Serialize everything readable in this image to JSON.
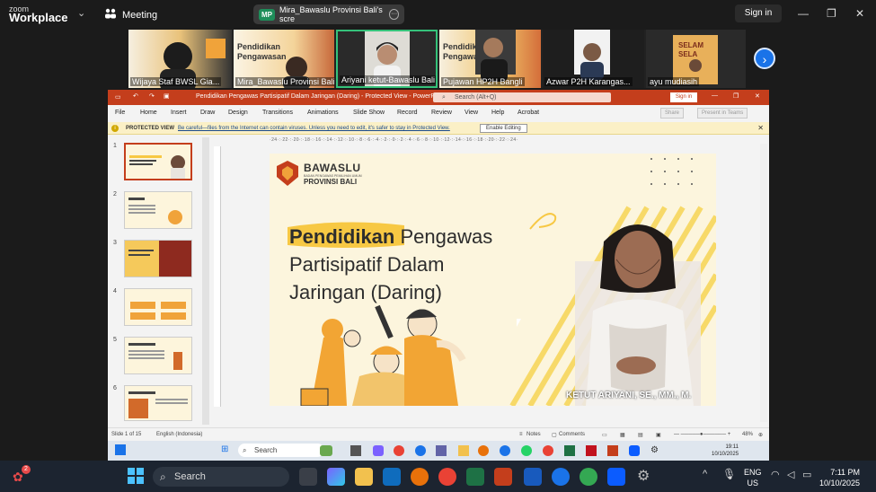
{
  "zoom": {
    "logo_line1": "zoom",
    "logo_line2": "Workplace",
    "meeting_label": "Meeting",
    "share_badge": "MP",
    "share_label": "Mira_Bawaslu Provinsi Bali's scre",
    "sign_in": "Sign in",
    "colors": {
      "bg": "#1b1b1b",
      "accent": "#1a73e8",
      "badge": "#1e8e5a"
    }
  },
  "participants": [
    {
      "name": "Wijaya Staf BWSL Gia..."
    },
    {
      "name": "Mira_Bawaslu Provinsi Bali"
    },
    {
      "name": "Ariyani ketut-Bawaslu Bali"
    },
    {
      "name": "Pujawan HP2H Bangli"
    },
    {
      "name": "Azwar P2H Karangas..."
    },
    {
      "name": "ayu mudiasih"
    }
  ],
  "ppt": {
    "title": "Pendidikan Pengawas Partisipatif Dalam Jaringan (Daring)  -  Protected View  -  PowerPoint",
    "search_placeholder": "Search (Alt+Q)",
    "sign_in": "Sign in",
    "menu": [
      "File",
      "Home",
      "Insert",
      "Draw",
      "Design",
      "Transitions",
      "Animations",
      "Slide Show",
      "Record",
      "Review",
      "View",
      "Help",
      "Acrobat"
    ],
    "share": "Share",
    "present": "Present in Teams",
    "protected_label": "PROTECTED VIEW",
    "protected_msg": "Be careful—files from the Internet can contain viruses. Unless you need to edit, it's safer to stay in Protected View.",
    "enable_editing": "Enable Editing",
    "thumb_numbers": [
      "1",
      "2",
      "3",
      "4",
      "5",
      "6"
    ],
    "ruler_top": "·24·:·22·:·20·:·18·:·16·:·14·:·12·:·10·:·8·:·6·:·4·:·2·:·0·:·2·:·4·:·6·:·8·:·10·:·12·:·14·:·16·:·18·:·20·:·22·:·24·",
    "status": {
      "slide_of": "Slide 1 of 15",
      "language": "English (Indonesia)",
      "notes": "Notes",
      "comments": "Comments",
      "zoom": "48%"
    },
    "colors": {
      "accent": "#c43e1c",
      "slide_bg": "#fcf5dd",
      "highlight": "#f7c843"
    }
  },
  "slide": {
    "brand": "BAWASLU",
    "brand_sub": "BADAN PENGAWAS PEMILIHAN UMUM",
    "brand_region": "PROVINSI BALI",
    "title_highlight": "Pendidikan",
    "title_rest1": " Pengawas",
    "title_line2": "Partisipatif Dalam",
    "title_line3": "Jaringan (Daring)",
    "speaker_caption": "KETUT ARIYANI, SE., MM., M."
  },
  "inner_taskbar": {
    "search": "Search",
    "time": "19:11",
    "date": "10/10/2025"
  },
  "taskbar": {
    "search": "Search",
    "lang_line1": "ENG",
    "lang_line2": "US",
    "time": "7:11 PM",
    "date": "10/10/2025",
    "notif_count": "2"
  }
}
